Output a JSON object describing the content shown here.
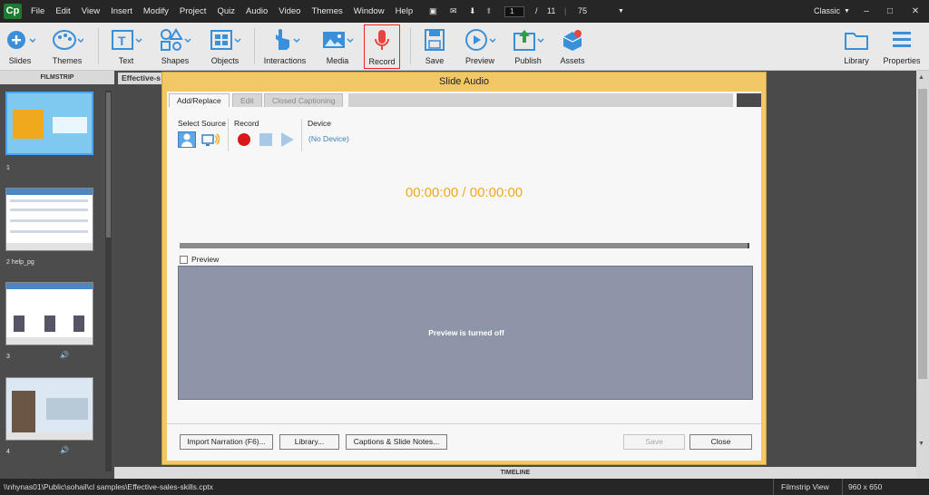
{
  "app": {
    "logo_text": "Cp",
    "menus": [
      "File",
      "Edit",
      "View",
      "Insert",
      "Modify",
      "Project",
      "Quiz",
      "Audio",
      "Video",
      "Themes",
      "Window",
      "Help"
    ],
    "current_page": "1",
    "page_sep": "/",
    "total_pages": "11",
    "zoom": "75",
    "workspace": "Classic"
  },
  "toolbar": {
    "slides": "Slides",
    "themes": "Themes",
    "text": "Text",
    "shapes": "Shapes",
    "objects": "Objects",
    "interactions": "Interactions",
    "media": "Media",
    "record": "Record",
    "save": "Save",
    "preview": "Preview",
    "publish": "Publish",
    "assets": "Assets",
    "library": "Library",
    "properties": "Properties"
  },
  "filmstrip": {
    "header": "FILMSTRIP",
    "slides": [
      {
        "label": "1"
      },
      {
        "label": "2 help_pg"
      },
      {
        "label": "3"
      },
      {
        "label": "4"
      }
    ]
  },
  "document": {
    "tab": "Effective-s"
  },
  "dialog": {
    "title": "Slide Audio",
    "tabs": [
      "Add/Replace",
      "Edit",
      "Closed Captioning"
    ],
    "select_source": "Select Source",
    "record": "Record",
    "device": "Device",
    "device_value": "(No Device)",
    "timer": "00:00:00 / 00:00:00",
    "preview_label": "Preview",
    "preview_message": "Preview is turned off",
    "buttons": {
      "import": "Import Narration (F6)...",
      "library": "Library...",
      "captions": "Captions & Slide Notes...",
      "save": "Save",
      "close": "Close"
    }
  },
  "timeline_label": "TIMELINE",
  "status": {
    "path": "\\\\nhynas01\\Public\\sohail\\cl samples\\Effective-sales-skills.cptx",
    "view": "Filmstrip View",
    "size": "960 x 650"
  },
  "colors": {
    "accent_orange": "#f0a81d",
    "record_red": "#d81818",
    "dialog_frame": "#f2c866",
    "link_blue": "#3a7fc9"
  }
}
